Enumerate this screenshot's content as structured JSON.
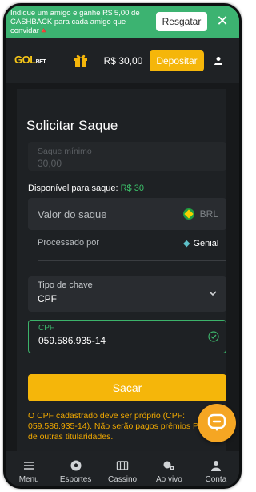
{
  "promo": {
    "text": "Indique um amigo e ganhe R$ 5,00 de CASHBACK para cada amigo que convidar🔺",
    "cta": "Resgatar"
  },
  "header": {
    "logo": "GOL",
    "logo_suffix": "BET",
    "balance": "R$ 30,00",
    "deposit": "Depositar"
  },
  "withdraw": {
    "title": "Solicitar Saque",
    "min_label": "Saque mínimo",
    "min_value": "30,00",
    "available_label": "Disponível para saque:",
    "available_value": "R$ 30",
    "amount_placeholder": "Valor do saque",
    "currency": "BRL",
    "processed_label": "Processado por",
    "processor": "Genial",
    "key_type_label": "Tipo de chave",
    "key_type_value": "CPF",
    "cpf_label": "CPF",
    "cpf_value": "059.586.935-14",
    "submit": "Sacar",
    "note": "O CPF cadastrado deve ser próprio (CPF: 059.586.935-14). Não serão pagos prêmios PIX de outras titularidades."
  },
  "nav": [
    {
      "label": "Menu",
      "icon": "menu-icon"
    },
    {
      "label": "Esportes",
      "icon": "soccer-ball-icon"
    },
    {
      "label": "Cassino",
      "icon": "slot-machine-icon"
    },
    {
      "label": "Ao vivo",
      "icon": "live-casino-icon"
    },
    {
      "label": "Conta",
      "icon": "user-icon"
    }
  ],
  "colors": {
    "accent": "#f5b60a",
    "promo_bg": "#3cb371",
    "success": "#3cb36a",
    "warning_text": "#f0a800",
    "background": "#1c1f22"
  }
}
